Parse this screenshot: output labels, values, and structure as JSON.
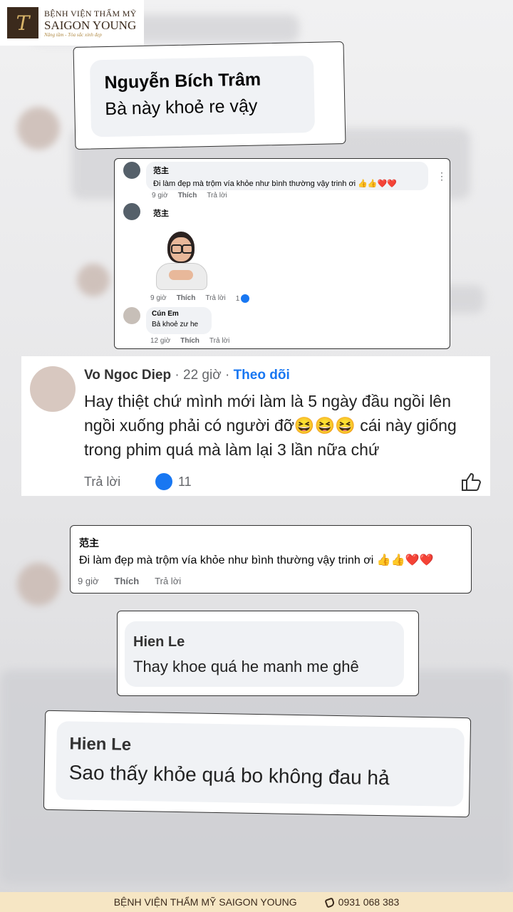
{
  "brand": {
    "line1": "BỆNH VIỆN THẨM MỸ",
    "line2": "SAIGON YOUNG",
    "tagline": "Nâng tầm - Tỏa sắc xinh đẹp",
    "mark": "T"
  },
  "card1": {
    "name": "Nguyễn Bích Trâm",
    "text": "Bà này khoẻ re vậy"
  },
  "card2": {
    "c1": {
      "name": "范主",
      "text": "Đi làm đẹp mà trộm vía khỏe như bình thường vậy trinh ơi 👍👍❤️❤️",
      "time": "9 giờ",
      "like": "Thích",
      "reply": "Trả lời"
    },
    "c2": {
      "name": "范主",
      "time": "9 giờ",
      "like": "Thích",
      "reply": "Trả lời",
      "likes": "1"
    },
    "c3": {
      "name": "Cún Em",
      "text": "Bả khoẻ zư he",
      "time": "12 giờ",
      "like": "Thích",
      "reply": "Trả lời"
    },
    "more": "⋮"
  },
  "card3": {
    "name": "Vo Ngoc Diep",
    "time": "22 giờ",
    "follow": "Theo dõi",
    "text": "Hay thiệt chứ mình mới làm là 5 ngày đầu ngồi lên ngồi xuống phải có người đỡ😆😆😆 cái này giống trong phim quá mà làm lại 3 lần nữa chứ",
    "reply": "Trả lời",
    "likes": "11"
  },
  "card4": {
    "name": "范主",
    "text": "Đi làm đẹp mà trộm vía khỏe như bình thường vậy trinh ơi 👍👍❤️❤️",
    "time": "9 giờ",
    "like": "Thích",
    "reply": "Trả lời"
  },
  "card5": {
    "name": "Hien Le",
    "text": "Thay khoe quá he manh me ghê"
  },
  "card6": {
    "name": "Hien Le",
    "text": "Sao thấy khỏe quá bo không đau hả"
  },
  "footer": {
    "hospital": "BỆNH VIỆN THẨM MỸ SAIGON YOUNG",
    "phone": "0931 068 383"
  },
  "colors": {
    "footer_bg": "#f6e6c4",
    "brand": "#3b2a1c",
    "fb_blue": "#1877f2"
  }
}
